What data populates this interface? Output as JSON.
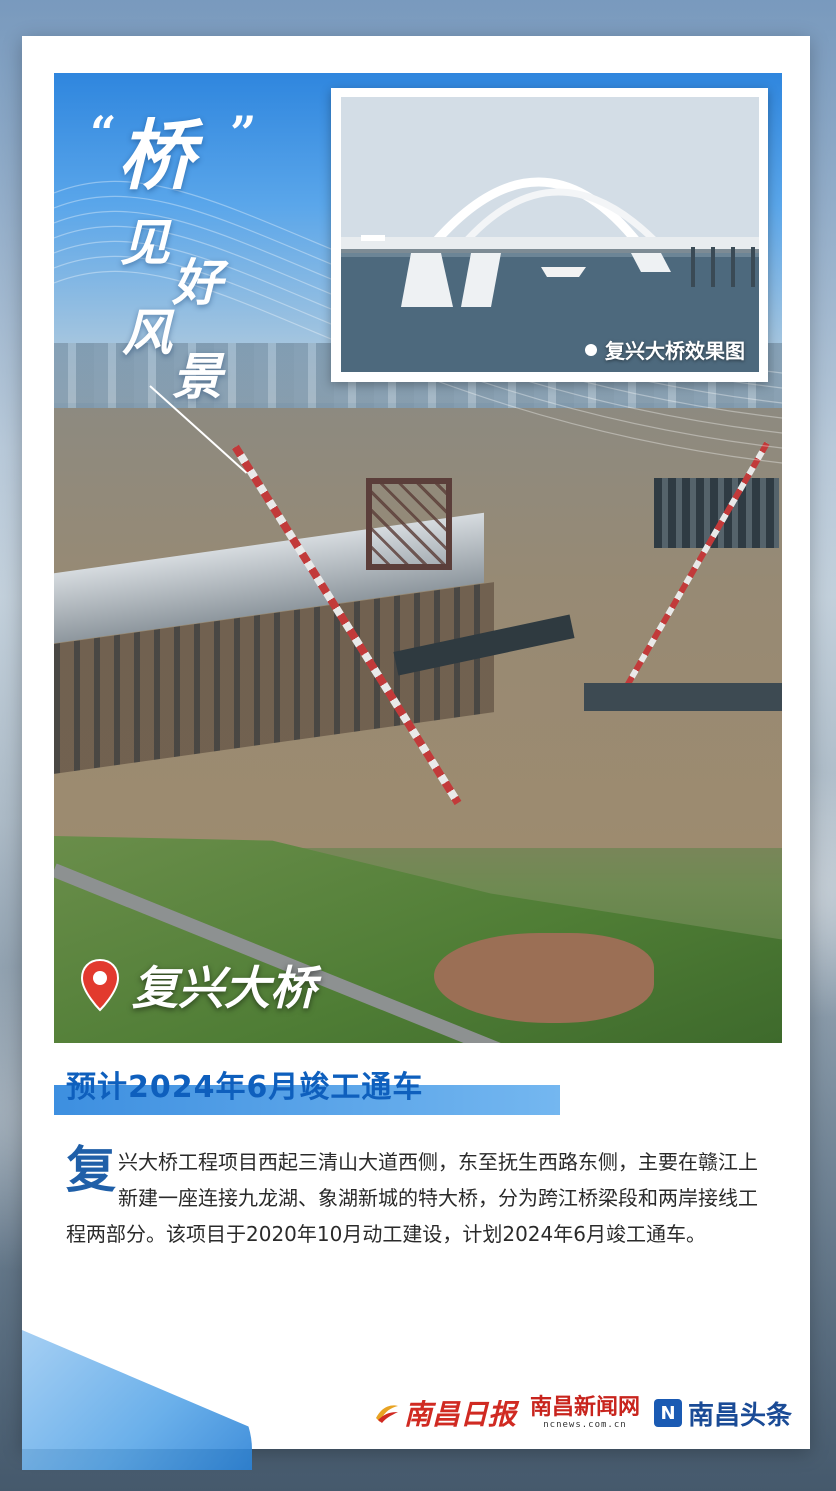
{
  "poster": {
    "title_quote_open": "“",
    "title_big": "桥",
    "title_quote_close": "”",
    "title_chars": [
      "见",
      "好",
      "风",
      "景"
    ],
    "inset_caption": "复兴大桥效果图",
    "location_name": "复兴大桥",
    "subtitle": "预计2024年6月竣工通车",
    "body_dropcap": "复",
    "body_text": "兴大桥工程项目西起三清山大道西侧，东至抚生西路东侧，主要在赣江上新建一座连接九龙湖、象湖新城的特大桥，分为跨江桥梁段和两岸接线工程两部分。该项目于2020年10月动工建设，计划2024年6月竣工通车。"
  },
  "logos": {
    "nanchang_daily": "南昌日报",
    "news_net": "南昌新闻网",
    "news_net_url": "ncnews.com.cn",
    "toutiao": "南昌头条",
    "toutiao_mark": "N"
  },
  "colors": {
    "accent_blue": "#0e5fbd",
    "bar_blue": "#3d8fe0",
    "logo_red": "#d02a22",
    "pin_red": "#e23a2e"
  }
}
